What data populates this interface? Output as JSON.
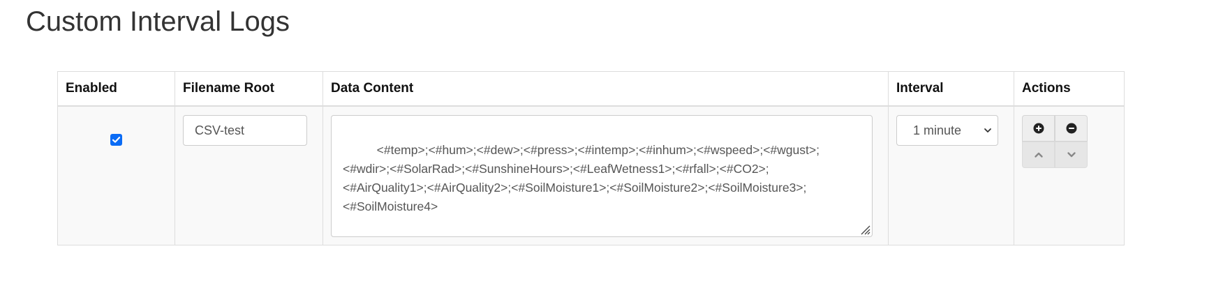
{
  "page": {
    "title": "Custom Interval Logs"
  },
  "table": {
    "headers": {
      "enabled": "Enabled",
      "filename": "Filename Root",
      "content": "Data Content",
      "interval": "Interval",
      "actions": "Actions"
    },
    "rows": [
      {
        "enabled": true,
        "filename": "CSV-test",
        "content": "<#temp>;<#hum>;<#dew>;<#press>;<#intemp>;<#inhum>;<#wspeed>;<#wgust>;\n<#wdir>;<#SolarRad>;<#SunshineHours>;<#LeafWetness1>;<#rfall>;<#CO2>;\n<#AirQuality1>;<#AirQuality2>;<#SoilMoisture1>;<#SoilMoisture2>;<#SoilMoisture3>;\n<#SoilMoisture4>",
        "interval": "1 minute"
      }
    ]
  },
  "icons": {
    "add": "plus-circle-icon",
    "remove": "minus-circle-icon",
    "up": "chevron-up-icon",
    "down": "chevron-down-icon",
    "checkbox": "checkmark-icon",
    "select": "chevron-down-icon"
  },
  "colors": {
    "checkbox": "#0b6cf5",
    "header_border": "#dddddd",
    "row_background": "#f9f9f9"
  }
}
